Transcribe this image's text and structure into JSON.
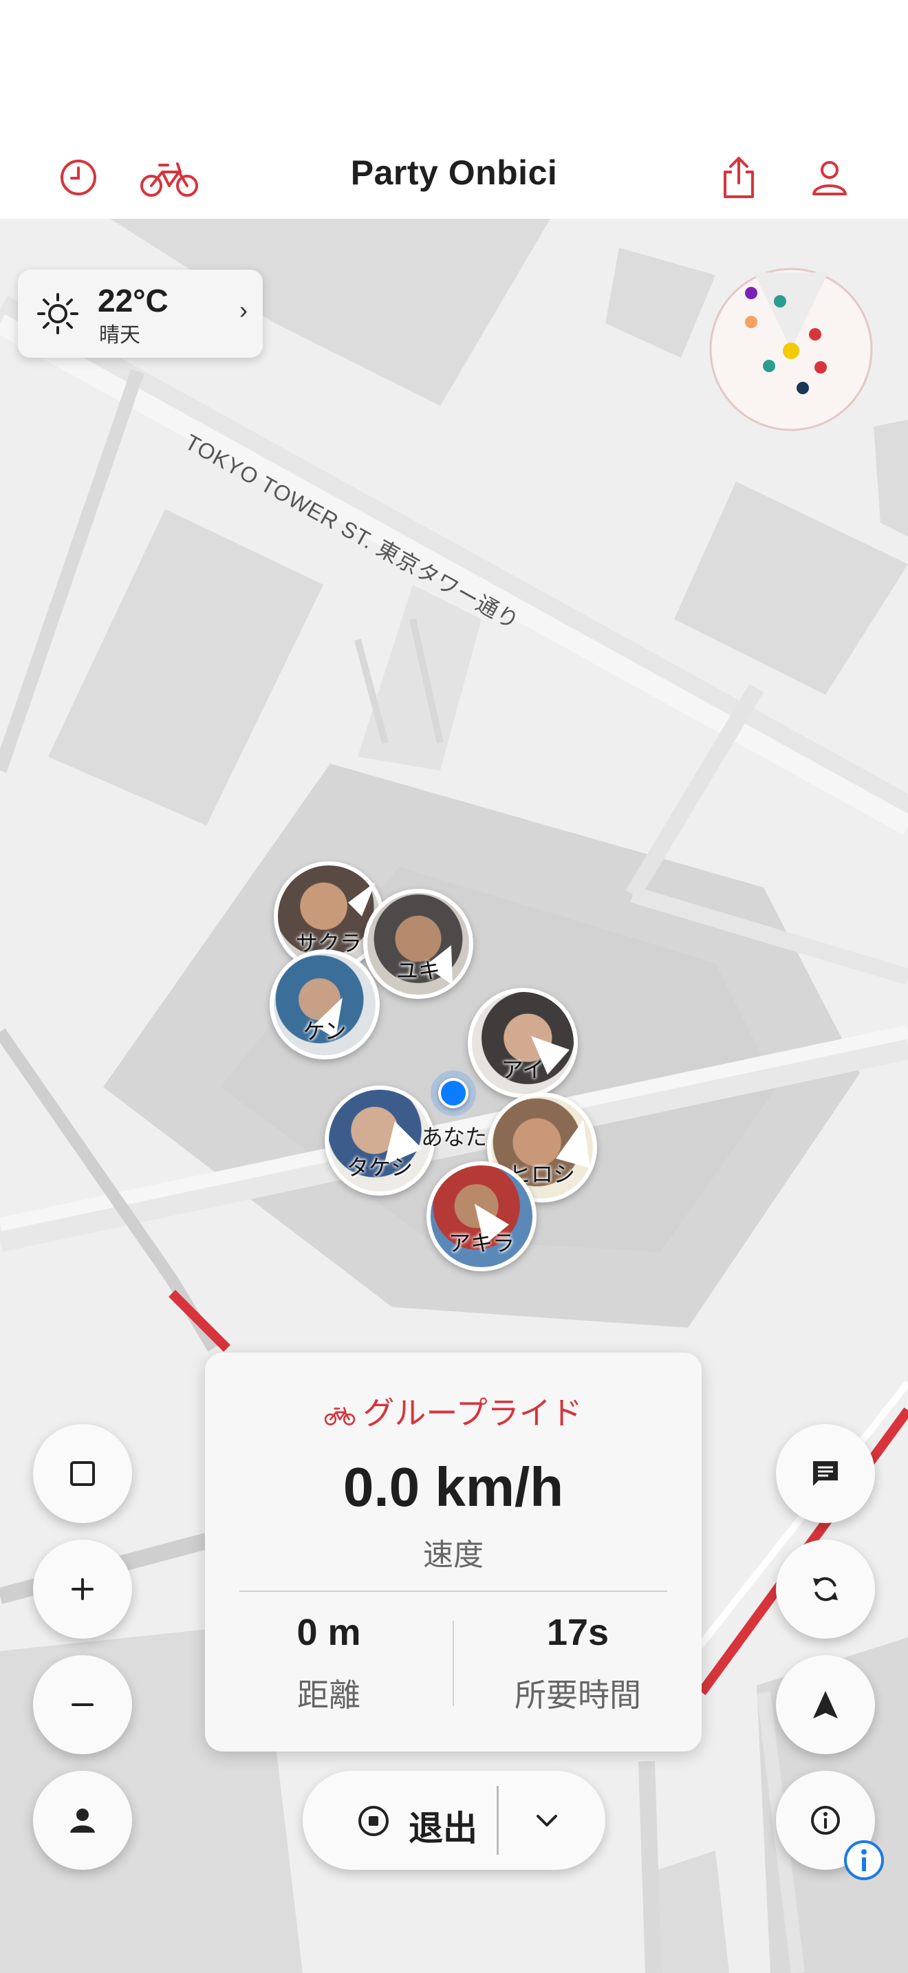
{
  "app": {
    "title": "Party Onbici",
    "accent": "#d8343b"
  },
  "header_icons": [
    "history-icon",
    "bicycle-icon",
    "share-icon",
    "profile-icon"
  ],
  "map": {
    "street_label": "TOKYO TOWER ST. 東京タワー通り"
  },
  "weather": {
    "temperature": "22°C",
    "condition": "晴天",
    "icon": "sun-icon",
    "chevron": "›"
  },
  "riders": [
    {
      "name": "サクラ"
    },
    {
      "name": "ユキ"
    },
    {
      "name": "ケン"
    },
    {
      "name": "アイ"
    },
    {
      "name": "タケシ"
    },
    {
      "name": "ヒロシ"
    },
    {
      "name": "アキラ"
    }
  ],
  "self_label": "あなた",
  "radar_colors": [
    "#7b22b5",
    "#2a9d8f",
    "#f4a261",
    "#f5c800",
    "#d8343b",
    "#2a9d8f",
    "#d8343b",
    "#1d3557"
  ],
  "left_controls": [
    "stop-square-icon",
    "zoom-in-icon",
    "zoom-out-icon",
    "person-icon"
  ],
  "right_controls": [
    "chat-icon",
    "sync-icon",
    "navigate-arrow-icon",
    "info-icon"
  ],
  "stats": {
    "mode_label": "グループライド",
    "speed": "0.0 km/h",
    "speed_label": "速度",
    "distance": "0 m",
    "distance_label": "距離",
    "duration": "17s",
    "duration_label": "所要時間"
  },
  "exit": {
    "label": "退出"
  }
}
